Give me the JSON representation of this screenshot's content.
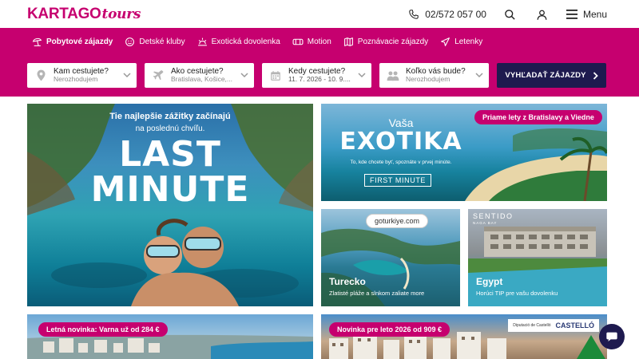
{
  "header": {
    "logo_main": "KARTAGO",
    "logo_script": "tours",
    "phone": "02/572 057 00",
    "menu_label": "Menu"
  },
  "nav": {
    "items": [
      {
        "label": "Pobytové zájazdy",
        "icon": "beach-umbrella-icon",
        "active": true
      },
      {
        "label": "Detské kluby",
        "icon": "kids-club-icon",
        "active": false
      },
      {
        "label": "Exotická dovolenka",
        "icon": "sun-icon",
        "active": false
      },
      {
        "label": "Motion",
        "icon": "motion-icon",
        "active": false
      },
      {
        "label": "Poznávacie zájazdy",
        "icon": "map-icon",
        "active": false
      },
      {
        "label": "Letenky",
        "icon": "plane-icon",
        "active": false
      }
    ]
  },
  "search": {
    "destination": {
      "label": "Kam cestujete?",
      "value": "Nerozhodujem",
      "icon": "location-pin-icon"
    },
    "departure": {
      "label": "Ako cestujete?",
      "value": "Bratislava, Košice,...",
      "icon": "plane-icon"
    },
    "dates": {
      "label": "Kedy cestujete?",
      "value": "11. 7. 2026 - 10. 9....",
      "icon": "calendar-icon"
    },
    "travelers": {
      "label": "Koľko vás bude?",
      "value": "Nerozhodujem",
      "icon": "people-icon"
    },
    "button_label": "VYHĽADAŤ ZÁJAZDY"
  },
  "tiles": {
    "last_minute": {
      "line1": "Tie najlepšie zážitky začínajú",
      "line2": "na poslednú chvíľu.",
      "big1": "LAST",
      "big2": "MINUTE"
    },
    "exotika": {
      "title1": "Vaša",
      "title2": "EXOTIKA",
      "subtitle": "To, kde chcete byť, spoznáte v prvej minúte.",
      "cta": "FIRST MINUTE",
      "badge": "Priame lety z Bratislavy a Viedne"
    },
    "turecko": {
      "logo": "goturkiye.com",
      "title": "Turecko",
      "subtitle": "Zlatisté pláže a slnkom zaliate more"
    },
    "egypt": {
      "brand": "SENTIDO",
      "brand_sub": "NAGA BAY",
      "title": "Egypt",
      "subtitle": "Horúci TIP pre vašu dovolenku"
    },
    "varna": {
      "badge": "Letná novinka: Varna už od 284 €"
    },
    "novinka": {
      "badge": "Novinka pre leto 2026 od 909 €",
      "partner1": "Diputació de Castelló",
      "partner2": "CASTELLÓ"
    }
  },
  "colors": {
    "brand": "#c6006f",
    "navy": "#1e1a4f"
  }
}
